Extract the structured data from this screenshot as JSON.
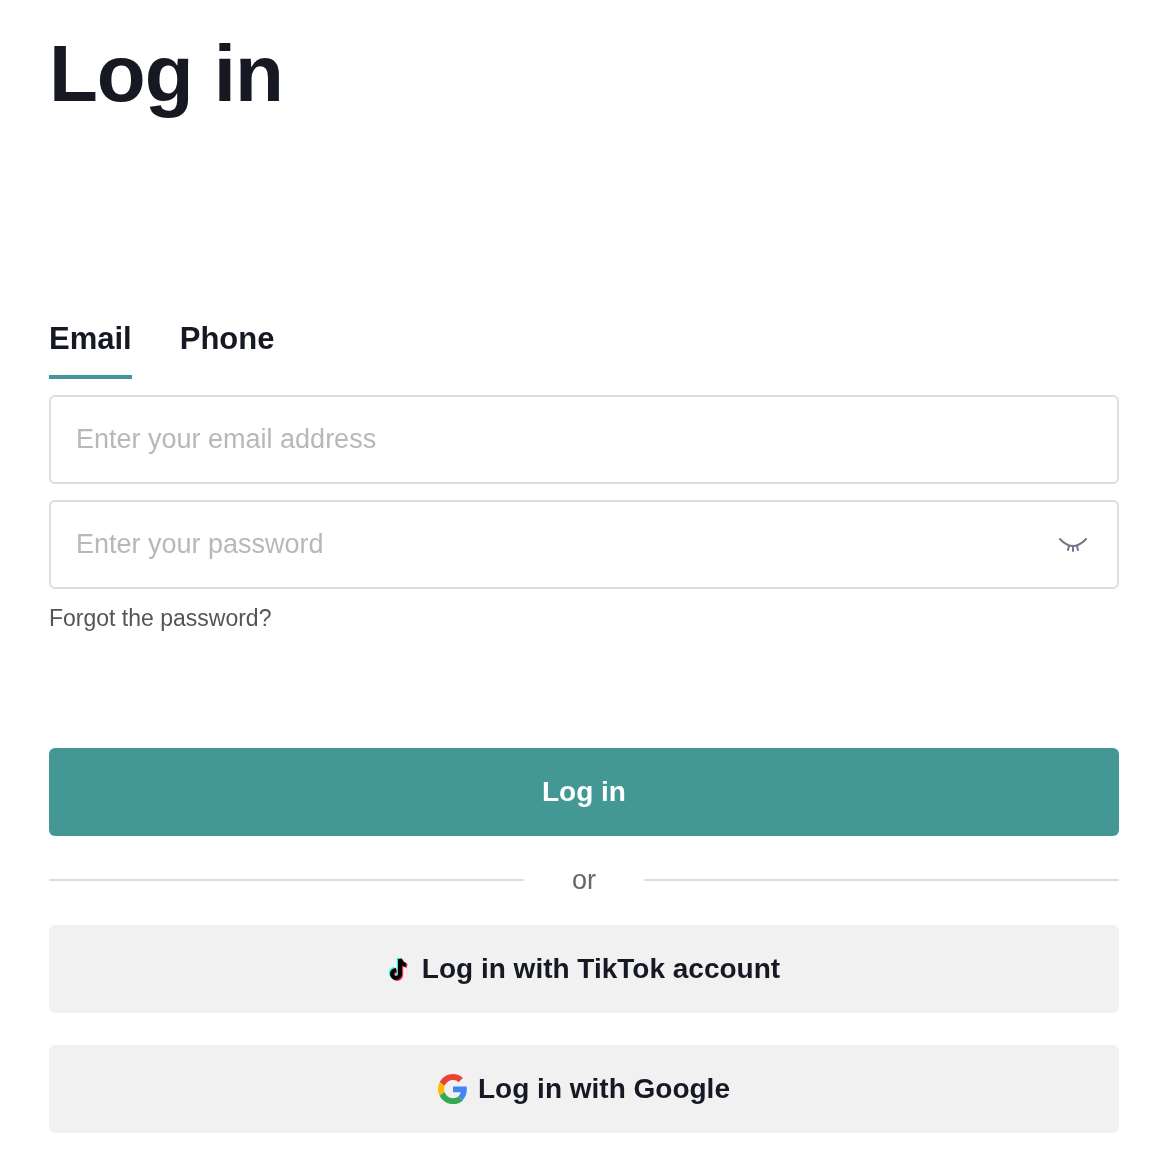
{
  "title": "Log in",
  "tabs": [
    {
      "label": "Email",
      "selected": true
    },
    {
      "label": "Phone",
      "selected": false
    }
  ],
  "email": {
    "placeholder": "Enter your email address"
  },
  "password": {
    "placeholder": "Enter your password"
  },
  "forgot_link": "Forgot the password?",
  "login_button": "Log in",
  "divider": "or",
  "social_buttons": [
    {
      "kind": "tiktok",
      "label": "Log in with TikTok account"
    },
    {
      "kind": "google",
      "label": "Log in with Google"
    }
  ]
}
